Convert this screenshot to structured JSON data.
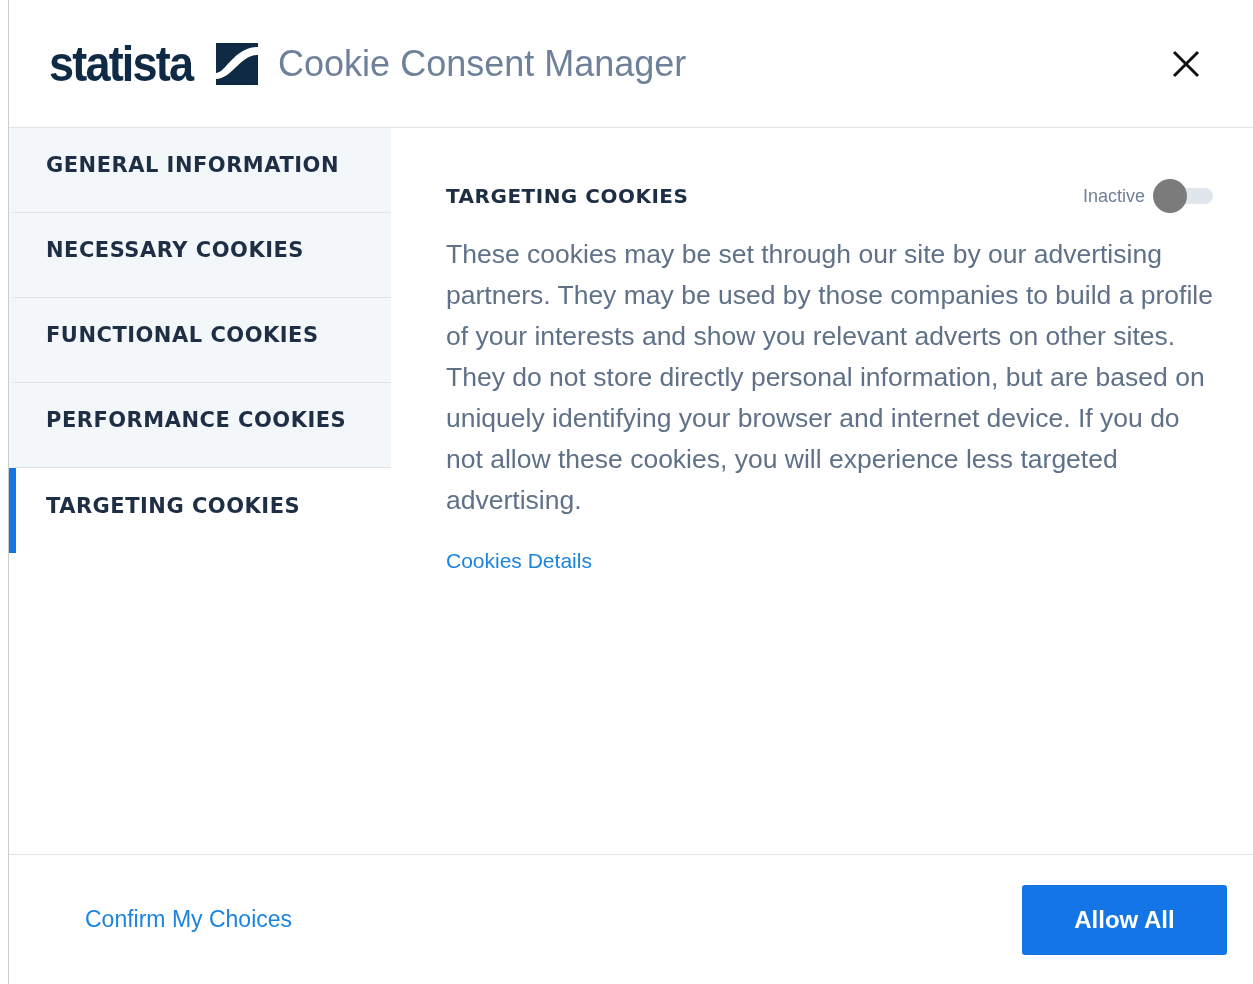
{
  "header": {
    "logo_text": "statista",
    "title": "Cookie Consent Manager"
  },
  "sidebar": {
    "items": [
      {
        "label": "GENERAL INFORMATION",
        "selected": false
      },
      {
        "label": "NECESSARY COOKIES",
        "selected": false
      },
      {
        "label": "FUNCTIONAL COOKIES",
        "selected": false
      },
      {
        "label": "PERFORMANCE COOKIES",
        "selected": false
      },
      {
        "label": "TARGETING COOKIES",
        "selected": true
      }
    ]
  },
  "panel": {
    "heading": "TARGETING COOKIES",
    "toggle_label": "Inactive",
    "toggle_on": false,
    "description": "These cookies may be set through our site by our advertising partners. They may be used by those companies to build a profile of your interests and show you relevant adverts on other sites. They do not store directly personal information, but are based on uniquely identifying your browser and internet device. If you do not allow these cookies, you will experience less targeted advertising.",
    "link": "Cookies Details"
  },
  "footer": {
    "confirm": "Confirm My Choices",
    "allow": "Allow All"
  }
}
